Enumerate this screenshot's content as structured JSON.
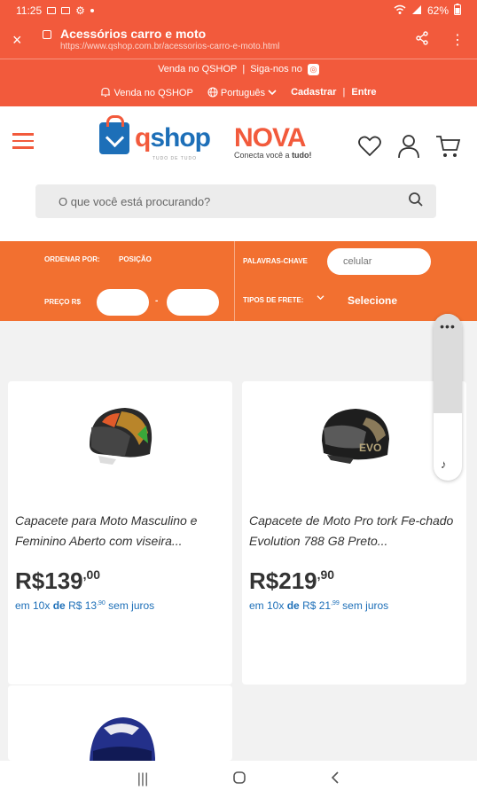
{
  "status": {
    "time": "11:25",
    "battery": "62%"
  },
  "browser": {
    "title": "Acessórios carro e moto",
    "url": "https://www.qshop.com.br/acessorios-carro-e-moto.html",
    "close_glyph": "×",
    "share_glyph": "⋖",
    "menu_glyph": "⋮"
  },
  "topstrip": {
    "sell_line": "Venda no QSHOP",
    "separator": "|",
    "follow": "Siga-nos no",
    "sell_link": "Venda no QSHOP",
    "language": "Português",
    "register": "Cadastrar",
    "login": "Entre"
  },
  "header": {
    "qshop_q": "q",
    "qshop_rest": "shop",
    "qshop_tagline": "TUDO DE TUDO",
    "nova_logo": "NOVA",
    "nova_slogan_pre": "Conecta você a",
    "nova_slogan_bold": "tudo!"
  },
  "search": {
    "placeholder": "O que você está procurando?"
  },
  "filters": {
    "sort_label": "ORDENAR POR:",
    "sort_value": "POSIÇÃO",
    "keywords_label": "PALAVRAS-CHAVE",
    "keywords_placeholder": "celular",
    "price_label": "PREÇO R$",
    "price_sep": "-",
    "shipping_label": "TIPOS DE FRETE:",
    "shipping_value": "Selecione"
  },
  "side_panel": {
    "dots": "•••",
    "music_glyph": "♪"
  },
  "products": [
    {
      "name": "Capacete para Moto Masculino e Feminino Aberto com viseira...",
      "price_main": "R$139",
      "price_cents": ",00",
      "inst_pre": "em 10x",
      "inst_de": "de",
      "inst_price": "R$ 13",
      "inst_cents": ",90",
      "inst_post": "sem juros"
    },
    {
      "name": "Capacete de Moto Pro tork Fe-chado Evolution 788 G8 Preto...",
      "price_main": "R$219",
      "price_cents": ",90",
      "inst_pre": "em 10x",
      "inst_de": "de",
      "inst_price": "R$ 21",
      "inst_cents": ",99",
      "inst_post": "sem juros"
    }
  ],
  "nav": {
    "recents": "|||",
    "home": "◯",
    "back": "〈"
  },
  "colors": {
    "brand_red": "#f25a3c",
    "filter_orange": "#f27030",
    "qshop_blue": "#1d6fb8"
  }
}
